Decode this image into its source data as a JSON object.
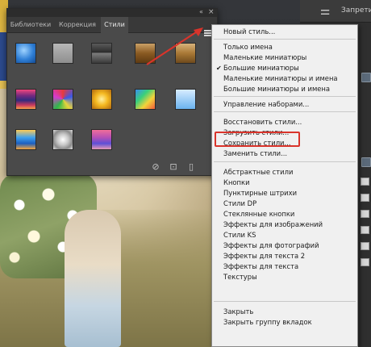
{
  "dock": {
    "label": "Запретить"
  },
  "panel": {
    "tabs": [
      {
        "label": "Библиотеки",
        "active": false
      },
      {
        "label": "Коррекция",
        "active": false
      },
      {
        "label": "Стили",
        "active": true
      }
    ],
    "collapse_glyph": "«",
    "close_glyph": "×",
    "swatches": [
      {
        "name": "blue-glass"
      },
      {
        "name": "gray-flat"
      },
      {
        "name": "dark-bevel"
      },
      {
        "name": "bronze"
      },
      {
        "name": "sunset-stripes"
      },
      {
        "name": "multicolor"
      },
      {
        "name": "gold"
      },
      {
        "name": "rainbow"
      },
      {
        "name": "sky-blue"
      },
      {
        "name": "blue-horizon"
      },
      {
        "name": "chrome"
      },
      {
        "name": "pink-purple"
      }
    ],
    "footer_icons": [
      "no-style-icon",
      "new-style-icon",
      "trash-icon"
    ]
  },
  "menu": {
    "items": [
      {
        "label": "Новый стиль...",
        "checked": false
      },
      {
        "label": "Только имена",
        "checked": false
      },
      {
        "label": "Маленькие миниатюры",
        "checked": false
      },
      {
        "label": "Большие миниатюры",
        "checked": true
      },
      {
        "label": "Маленькие миниатюры и имена",
        "checked": false
      },
      {
        "label": "Большие миниатюры и имена",
        "checked": false
      },
      {
        "label": "Управление наборами...",
        "checked": false
      },
      {
        "label": "Восстановить стили...",
        "checked": false
      },
      {
        "label": "Загрузить стили...",
        "checked": false
      },
      {
        "label": "Сохранить стили...",
        "checked": false
      },
      {
        "label": "Заменить стили...",
        "checked": false
      },
      {
        "label": "Абстрактные стили",
        "checked": false
      },
      {
        "label": "Кнопки",
        "checked": false
      },
      {
        "label": "Пунктирные штрихи",
        "checked": false
      },
      {
        "label": "Стили DP",
        "checked": false
      },
      {
        "label": "Стеклянные кнопки",
        "checked": false
      },
      {
        "label": "Эффекты для изображений",
        "checked": false
      },
      {
        "label": "Стили KS",
        "checked": false
      },
      {
        "label": "Эффекты для фотографий",
        "checked": false
      },
      {
        "label": "Эффекты для текста 2",
        "checked": false
      },
      {
        "label": "Эффекты для текста",
        "checked": false
      },
      {
        "label": "Текстуры",
        "checked": false
      },
      {
        "label": "Закрыть",
        "checked": false
      },
      {
        "label": "Закрыть группу вкладок",
        "checked": false
      }
    ],
    "highlighted_item": "Загрузить стили...",
    "highlight_color": "#d9342b"
  },
  "annotation": {
    "arrow_color": "#d9342b"
  }
}
